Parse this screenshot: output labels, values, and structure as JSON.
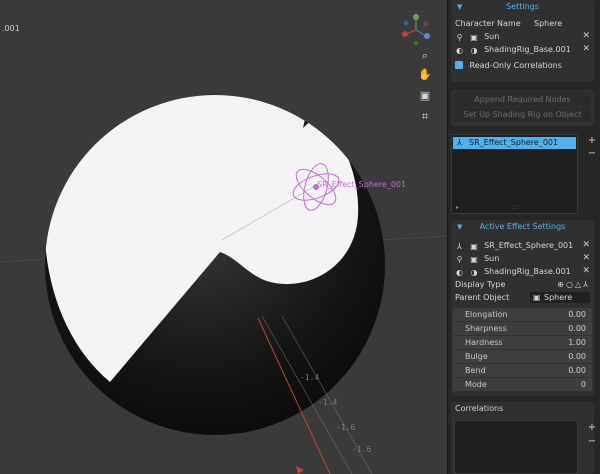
{
  "viewport": {
    "hud_label": ".001",
    "empty_label": "SR_Effect_Sphere_001",
    "axis_ticks": [
      "1.4",
      "1.4",
      "1.6",
      "1.6"
    ],
    "icons": [
      "zoom-icon",
      "pan-hand-icon",
      "camera-icon",
      "grid-icon"
    ]
  },
  "settings": {
    "header": "Settings",
    "character_name_label": "Character Name",
    "character_name_value": "Sphere",
    "light_name": "Sun",
    "rig_name": "ShadingRig_Base.001",
    "readonly_label": "Read-Only Correlations",
    "append_label": "Append Required Nodes",
    "setup_label": "Set Up Shading Rig on Object"
  },
  "effects_list": {
    "items": [
      "SR_Effect_Sphere_001"
    ],
    "plus": "+",
    "minus": "−"
  },
  "active_effect": {
    "header": "Active Effect Settings",
    "effect_name": "SR_Effect_Sphere_001",
    "light_name": "Sun",
    "rig_name": "ShadingRig_Base.001",
    "display_type_label": "Display Type",
    "parent_object_label": "Parent Object",
    "parent_object_value": "Sphere",
    "properties": [
      {
        "label": "Elongation",
        "value": "0.00"
      },
      {
        "label": "Sharpness",
        "value": "0.00"
      },
      {
        "label": "Hardness",
        "value": "1.00"
      },
      {
        "label": "Bulge",
        "value": "0.00"
      },
      {
        "label": "Bend",
        "value": "0.00"
      },
      {
        "label": "Mode",
        "value": "0"
      }
    ]
  },
  "correlations": {
    "header": "Correlations",
    "plus": "+",
    "minus": "−"
  },
  "colors": {
    "accent": "#4fb2f0",
    "empty_purple": "#c46bd3",
    "viewport_bg": "#3a3a3a"
  }
}
